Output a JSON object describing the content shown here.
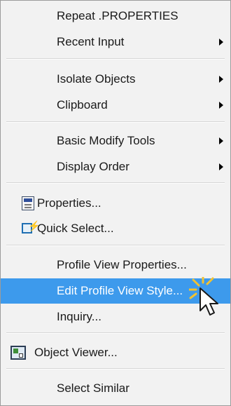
{
  "menu": {
    "items": [
      {
        "label": "Repeat .PROPERTIES",
        "submenu": false
      },
      {
        "label": "Recent Input",
        "submenu": true
      },
      {
        "label": "Isolate Objects",
        "submenu": true
      },
      {
        "label": "Clipboard",
        "submenu": true
      },
      {
        "label": "Basic Modify Tools",
        "submenu": true
      },
      {
        "label": "Display Order",
        "submenu": true
      },
      {
        "label": "Properties...",
        "icon": "properties-icon"
      },
      {
        "label": "Quick Select...",
        "icon": "quick-select-icon"
      },
      {
        "label": "Profile View Properties...",
        "submenu": false
      },
      {
        "label": "Edit Profile View Style...",
        "submenu": false,
        "highlighted": true
      },
      {
        "label": "Inquiry...",
        "submenu": true
      },
      {
        "label": "Object Viewer...",
        "icon": "object-viewer-icon"
      },
      {
        "label": "Select Similar",
        "submenu": false
      }
    ]
  },
  "colors": {
    "menu_background": "#f2f2f2",
    "highlight": "#3d9aec",
    "highlight_text": "#ffffff",
    "cursor_glow": "#f2c230"
  }
}
